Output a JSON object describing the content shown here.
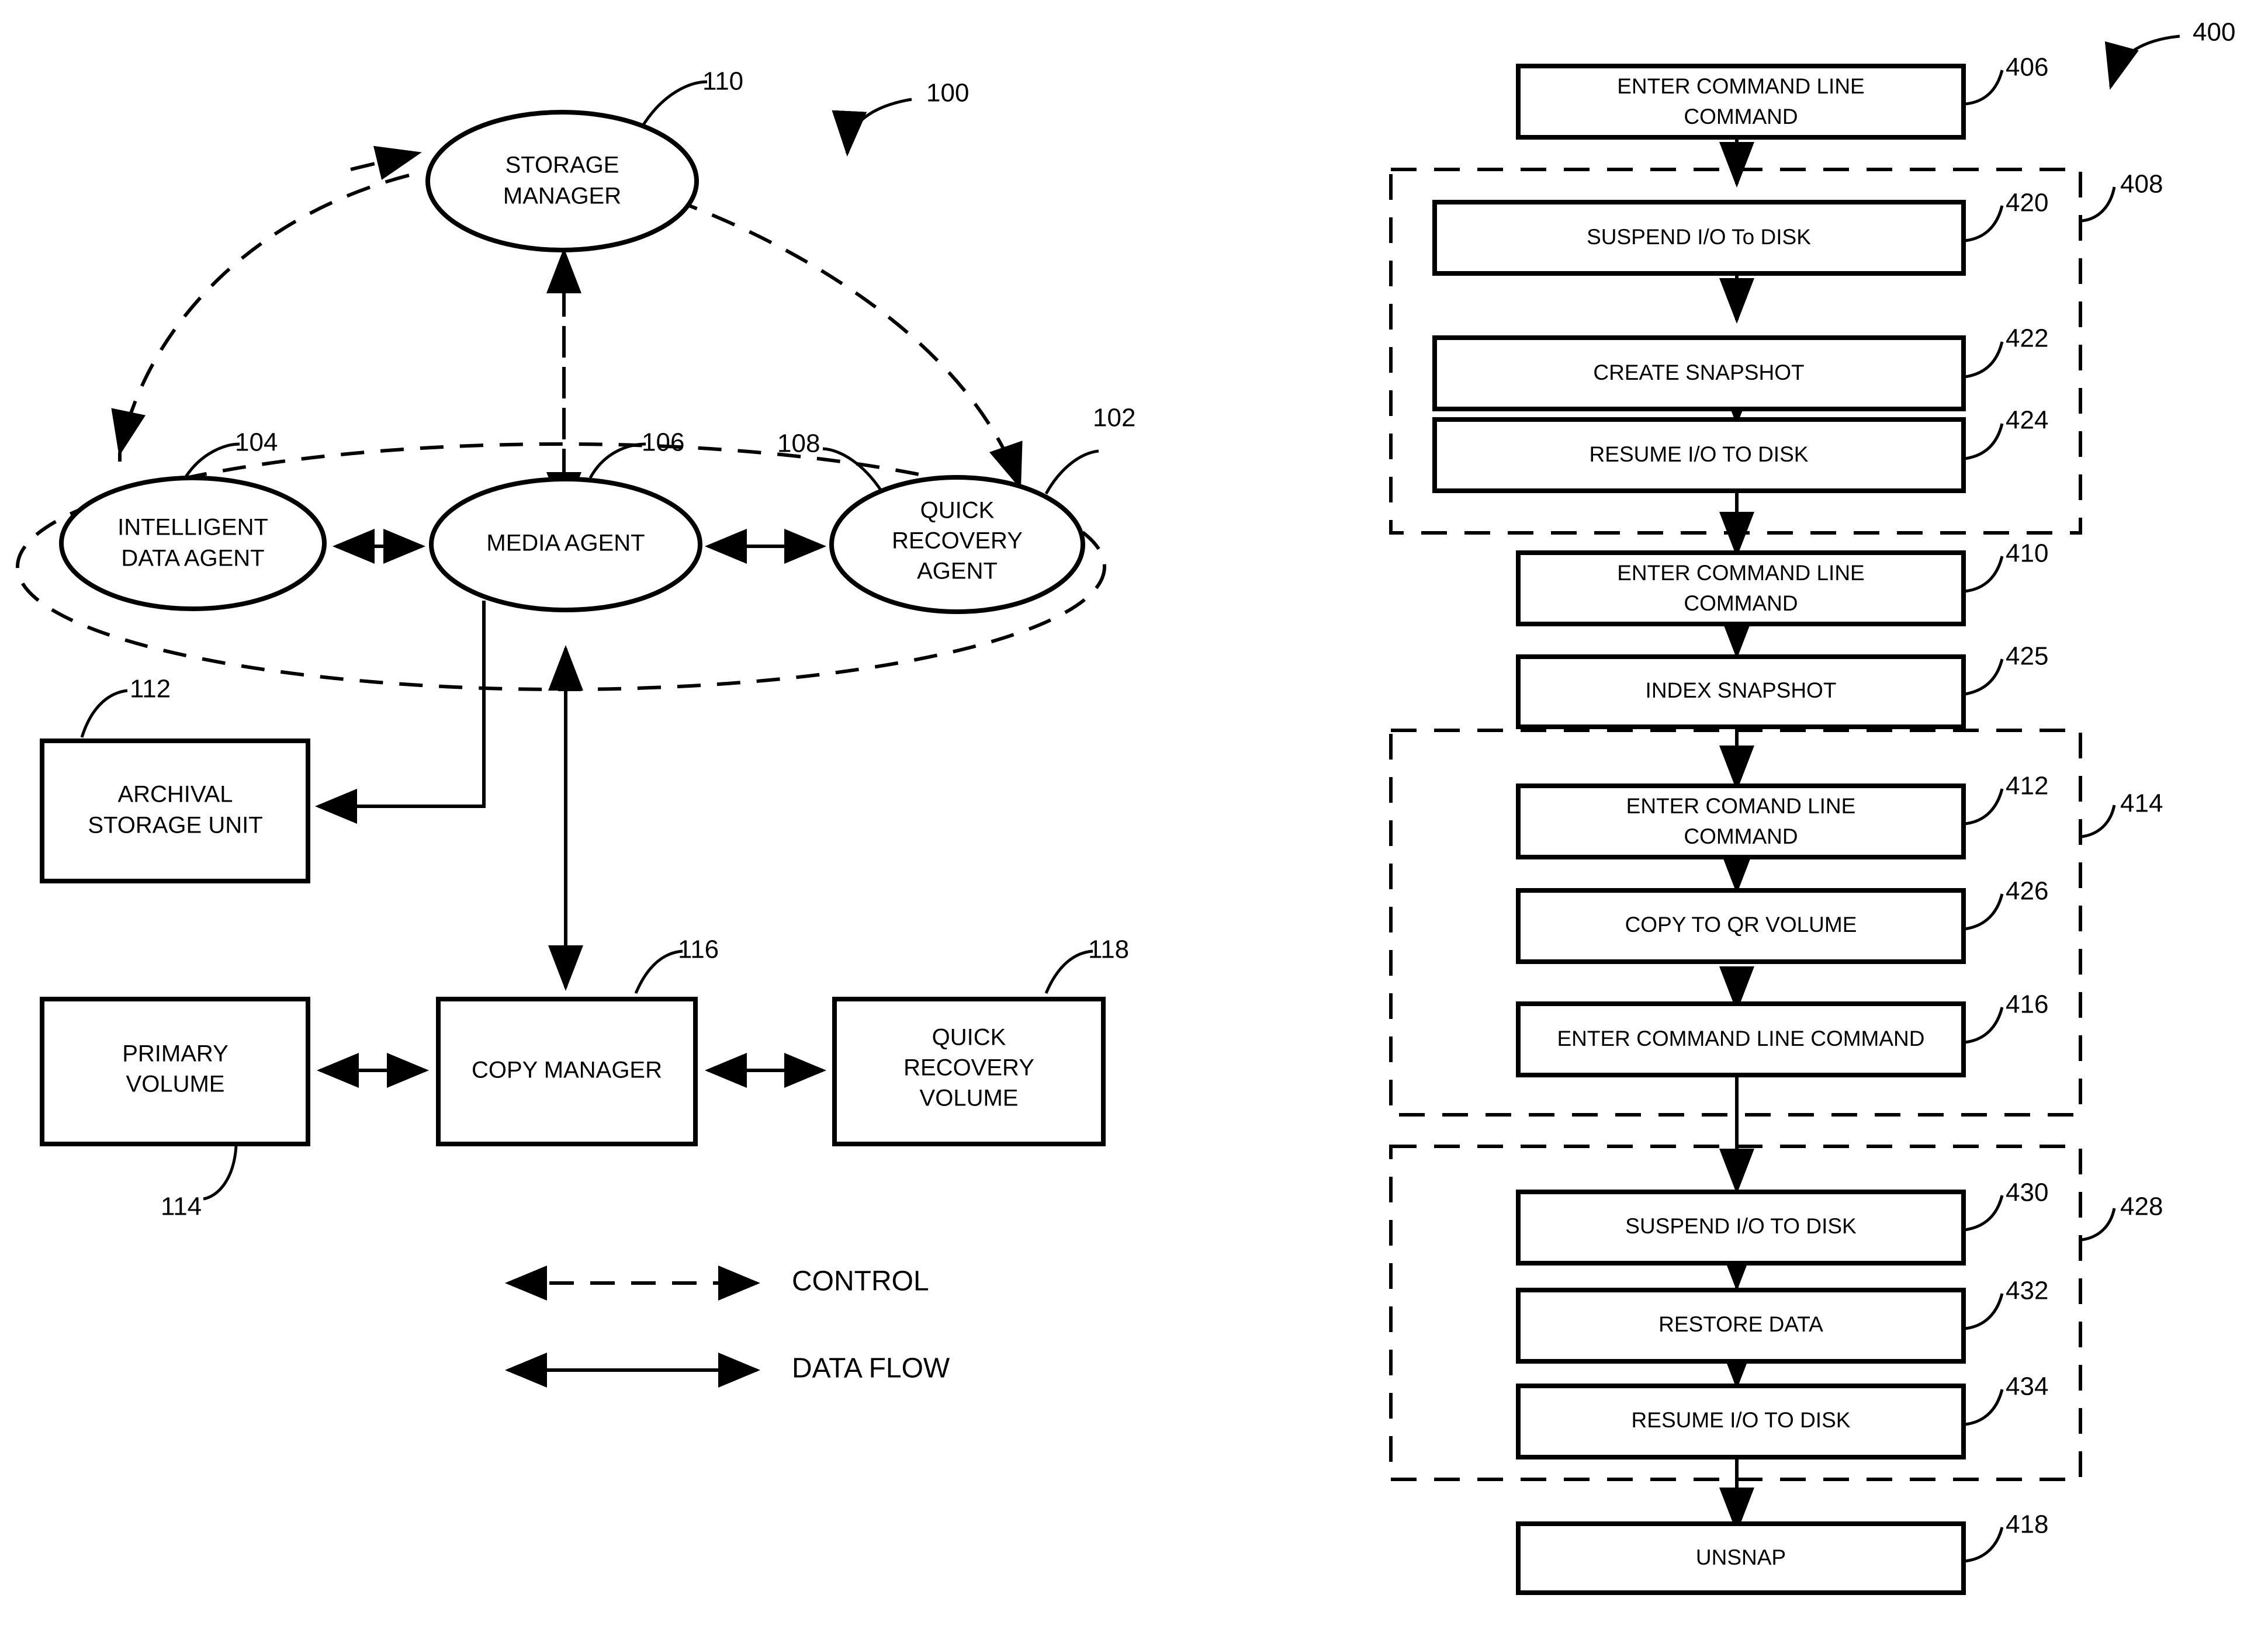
{
  "figure_left": {
    "ref_system": "100",
    "ref_agent_group": "102",
    "nodes": [
      {
        "id": "storage-manager",
        "label_lines": [
          "STORAGE",
          "MANAGER"
        ],
        "ref": "110"
      },
      {
        "id": "intelligent-data-agent",
        "label_lines": [
          "INTELLIGENT",
          "DATA AGENT"
        ],
        "ref": "104"
      },
      {
        "id": "media-agent",
        "label_lines": [
          "MEDIA AGENT"
        ],
        "ref": "106"
      },
      {
        "id": "quick-recovery-agent",
        "label_lines": [
          "QUICK",
          "RECOVERY",
          "AGENT"
        ],
        "ref": "108"
      }
    ],
    "boxes": [
      {
        "id": "archival-storage-unit",
        "label_lines": [
          "ARCHIVAL",
          "STORAGE UNIT"
        ],
        "ref": "112"
      },
      {
        "id": "primary-volume",
        "label_lines": [
          "PRIMARY",
          "VOLUME"
        ],
        "ref": "114"
      },
      {
        "id": "copy-manager",
        "label_lines": [
          "COPY MANAGER"
        ],
        "ref": "116"
      },
      {
        "id": "quick-recovery-volume",
        "label_lines": [
          "QUICK",
          "RECOVERY",
          "VOLUME"
        ],
        "ref": "118"
      }
    ],
    "legend": [
      {
        "id": "legend-control",
        "label": "CONTROL",
        "line_style": "dashed"
      },
      {
        "id": "legend-data-flow",
        "label": "DATA FLOW",
        "line_style": "solid"
      }
    ]
  },
  "figure_right": {
    "ref_process": "400",
    "steps": [
      {
        "id": "step-406",
        "ref": "406",
        "label_lines": [
          "ENTER COMMAND LINE",
          "COMMAND"
        ]
      },
      {
        "id": "step-420",
        "ref": "420",
        "label_lines": [
          "SUSPEND I/O To DISK"
        ]
      },
      {
        "id": "step-422",
        "ref": "422",
        "label_lines": [
          "CREATE SNAPSHOT"
        ]
      },
      {
        "id": "step-424",
        "ref": "424",
        "label_lines": [
          "RESUME I/O TO DISK"
        ]
      },
      {
        "id": "step-410",
        "ref": "410",
        "label_lines": [
          "ENTER COMMAND LINE",
          "COMMAND"
        ]
      },
      {
        "id": "step-425",
        "ref": "425",
        "label_lines": [
          "INDEX SNAPSHOT"
        ]
      },
      {
        "id": "step-412",
        "ref": "412",
        "label_lines": [
          "ENTER COMAND LINE",
          "COMMAND"
        ]
      },
      {
        "id": "step-426",
        "ref": "426",
        "label_lines": [
          "COPY TO QR VOLUME"
        ]
      },
      {
        "id": "step-416",
        "ref": "416",
        "label_lines": [
          "ENTER COMMAND LINE COMMAND"
        ]
      },
      {
        "id": "step-430",
        "ref": "430",
        "label_lines": [
          "SUSPEND I/O TO DISK"
        ]
      },
      {
        "id": "step-432",
        "ref": "432",
        "label_lines": [
          "RESTORE DATA"
        ]
      },
      {
        "id": "step-434",
        "ref": "434",
        "label_lines": [
          "RESUME I/O TO DISK"
        ]
      },
      {
        "id": "step-418",
        "ref": "418",
        "label_lines": [
          "UNSNAP"
        ]
      }
    ],
    "groups": [
      {
        "id": "group-408",
        "ref": "408"
      },
      {
        "id": "group-414",
        "ref": "414"
      },
      {
        "id": "group-428",
        "ref": "428"
      }
    ]
  },
  "colors": {
    "ink": "#000000",
    "paper": "#ffffff"
  }
}
